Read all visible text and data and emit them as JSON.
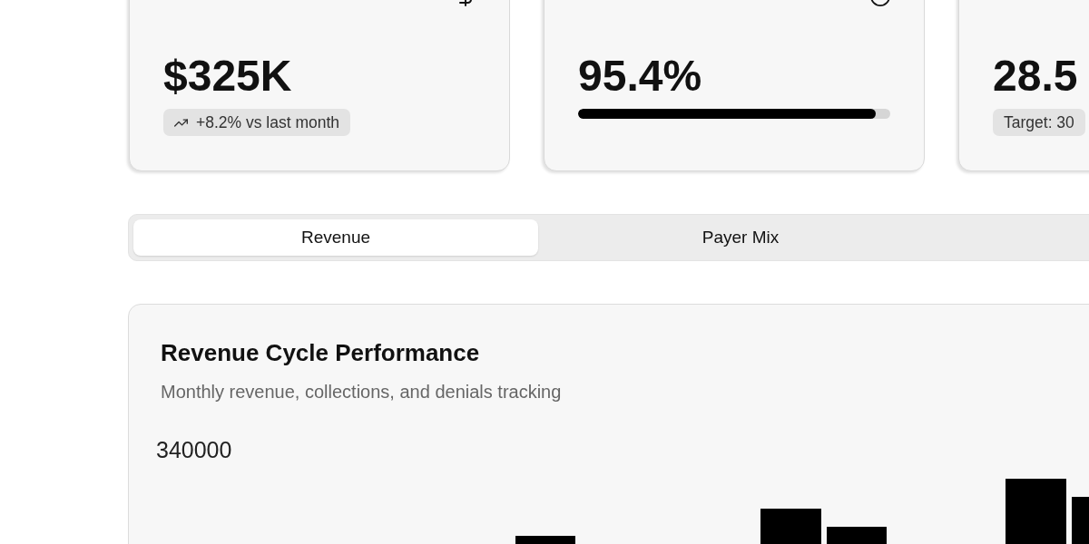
{
  "metrics": [
    {
      "kind": "trend",
      "value": "$325K",
      "badge": "+8.2% vs last month"
    },
    {
      "kind": "progress",
      "value": "95.4%",
      "level": 0.954
    },
    {
      "kind": "note",
      "value": "28.5",
      "badge": "Target: 30"
    }
  ],
  "tabs": [
    {
      "label": "Revenue",
      "selected": true
    },
    {
      "label": "Payer Mix",
      "selected": false
    }
  ],
  "chart_panel": {
    "title": "Revenue Cycle Performance",
    "subtitle": "Monthly revenue, collections, and denials tracking",
    "y_tick_label": "340000"
  }
}
